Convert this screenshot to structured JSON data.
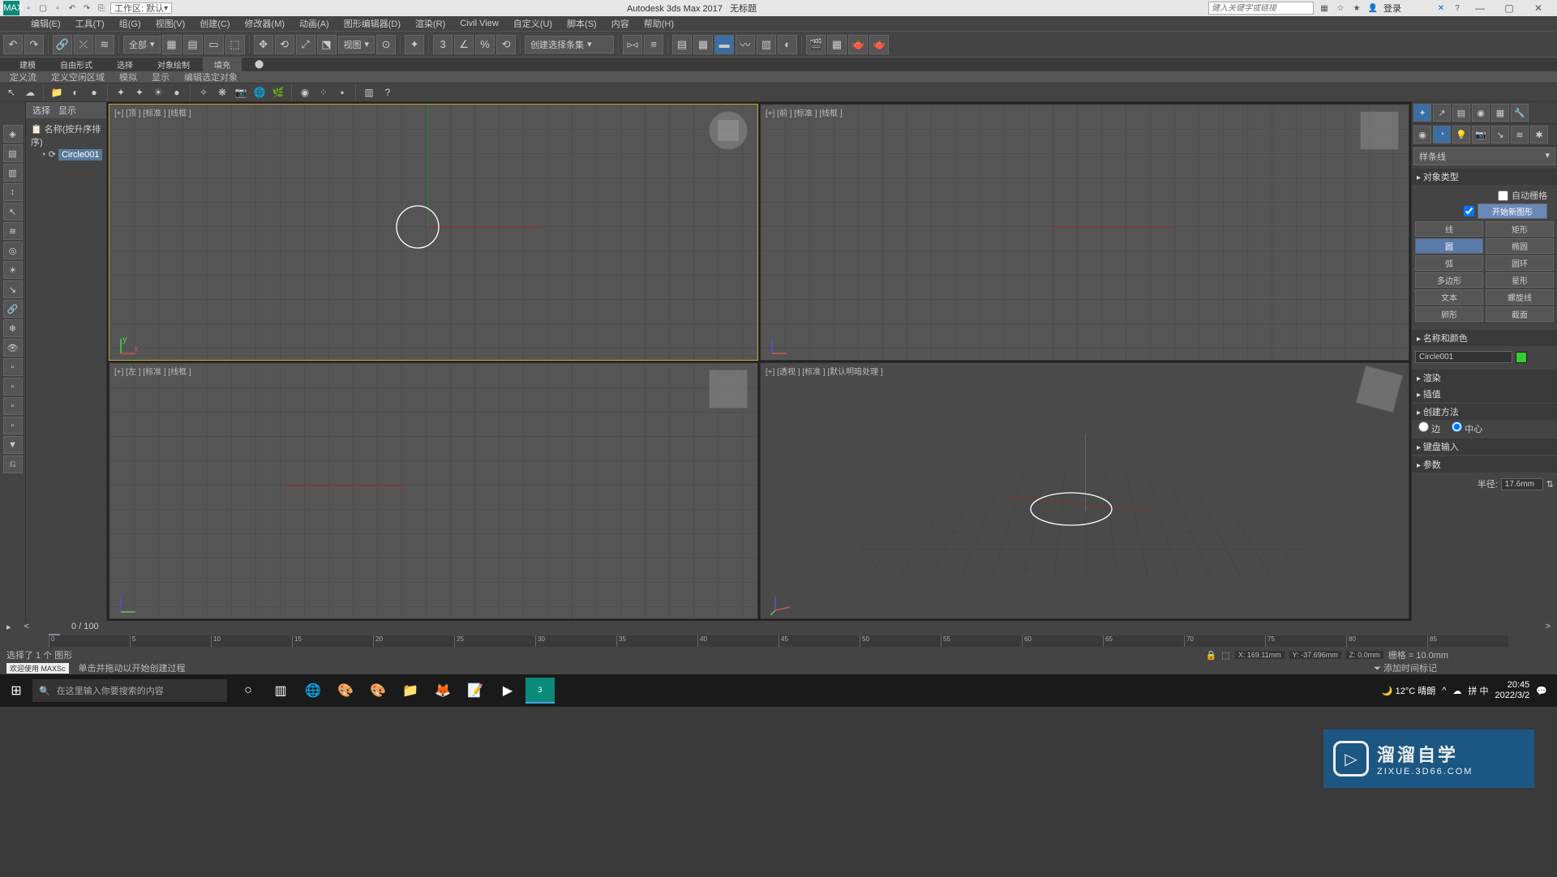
{
  "title": {
    "app": "Autodesk 3ds Max 2017",
    "doc": "无标题",
    "workspace_label": "工作区: 默认",
    "search_ph": "健入关键字或链接",
    "login": "登录"
  },
  "menu": [
    "编辑(E)",
    "工具(T)",
    "组(G)",
    "视图(V)",
    "创建(C)",
    "修改器(M)",
    "动画(A)",
    "图形编辑器(D)",
    "渲染(R)",
    "Civil View",
    "自定义(U)",
    "脚本(S)",
    "内容",
    "帮助(H)"
  ],
  "toolbar": {
    "allcombo": "全部",
    "viewcombo": "视图",
    "selsetcombo": "创建选择条集"
  },
  "ribbon_tabs": [
    "建模",
    "自由形式",
    "选择",
    "对象绘制",
    "填充"
  ],
  "subribbon": [
    "定义流",
    "定义空闲区域",
    "模拟",
    "显示",
    "编辑选定对象"
  ],
  "scene": {
    "cols": [
      "选择",
      "显示"
    ],
    "sort": "名称(按升序排序)",
    "node": "Circle001"
  },
  "viewports": {
    "top": "[+] [顶 ] [标准 ] [线框 ]",
    "front": "[+] [前 ] [标准 ] [线框 ]",
    "left": "[+] [左 ] [标准 ] [线框 ]",
    "persp": "[+] [透视 ] [标准 ] [默认明暗处理 ]"
  },
  "cmd": {
    "dropdown": "样条线",
    "obj_type_hdr": "对象类型",
    "auto_grid": "自动栅格",
    "start_new": "开始新图形",
    "btns": [
      [
        "线",
        "矩形"
      ],
      [
        "圆",
        "椭圆"
      ],
      [
        "弧",
        "圆环"
      ],
      [
        "多边形",
        "星形"
      ],
      [
        "文本",
        "螺旋线"
      ],
      [
        "卵形",
        "截面"
      ]
    ],
    "active_btn": "圆",
    "namecolor_hdr": "名称和颜色",
    "name": "Circle001",
    "render_hdr": "渲染",
    "interp_hdr": "插值",
    "create_hdr": "创建方法",
    "radio_edge": "边",
    "radio_center": "中心",
    "kbd_hdr": "键盘输入",
    "param_hdr": "参数",
    "radius_label": "半径:",
    "radius": "17.6mm"
  },
  "timeline": {
    "pos": "0 / 100",
    "ticks": [
      "0",
      "5",
      "10",
      "15",
      "20",
      "25",
      "30",
      "35",
      "40",
      "45",
      "50",
      "55",
      "60",
      "65",
      "70",
      "75",
      "80",
      "85"
    ]
  },
  "status": {
    "sel": "选择了 1 个 图形",
    "maxscript": "欢迎使用 MAXSc",
    "prompt": "单击并拖动以开始创建过程",
    "x": "X: 169.11mm",
    "y": "Y: -37.696mm",
    "z": "Z: 0.0mm",
    "grid": "栅格 = 10.0mm",
    "addkey": "添加时间标记"
  },
  "watermark": {
    "name": "溜溜自学",
    "url": "ZIXUE.3D66.COM"
  },
  "taskbar": {
    "search_ph": "在这里输入你要搜索的内容",
    "weather": "12°C 晴朗",
    "ime": "拼 中",
    "time": "20:45",
    "date": "2022/3/2"
  }
}
